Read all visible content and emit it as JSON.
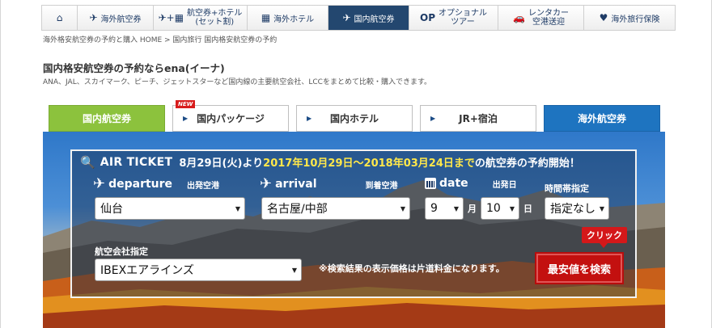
{
  "nav": {
    "items": [
      {
        "label": "",
        "icon": "home-icon",
        "glyph": "⌂"
      },
      {
        "label": "海外航空券",
        "icon": "plane-icon",
        "glyph": "✈"
      },
      {
        "label": "航空券+ホテル",
        "sub": "(セット割)",
        "icon": "plane-hotel-icon",
        "glyph": "✈+▦"
      },
      {
        "label": "海外ホテル",
        "icon": "hotel-icon",
        "glyph": "▦"
      },
      {
        "label": "国内航空券",
        "icon": "domestic-plane-icon",
        "glyph": "✈",
        "active": true
      },
      {
        "label": "オプショナル",
        "sub": "ツアー",
        "icon": "op-icon",
        "glyph": "OP"
      },
      {
        "label": "レンタカー",
        "sub": "空港送迎",
        "icon": "car-icon",
        "glyph": "🚗"
      },
      {
        "label": "海外旅行保険",
        "icon": "heart-icon",
        "glyph": "♥"
      }
    ]
  },
  "breadcrumb": "海外格安航空券の予約と購入 HOME > 国内旅行 国内格安航空券の予約",
  "headline": "国内格安航空券の予約ならena(イーナ)",
  "subline": "ANA、JAL、スカイマーク、ピーチ、ジェットスターなど国内線の主要航空会社、LCCをまとめて比較・購入できます。",
  "tabs": {
    "domestic_flight": "国内航空券",
    "package": "国内パッケージ",
    "new_badge": "NEW",
    "hotel": "国内ホテル",
    "jr": "JR+宿泊",
    "overseas": "海外航空券"
  },
  "panel": {
    "air_ticket": "AIR TICKET",
    "title_pre": "8月29日(火)より",
    "title_highlight": "2017年10月29日〜2018年03月24日まで",
    "title_post": "の航空券の予約開始！",
    "departure_en": "departure",
    "departure_jp": "出発空港",
    "departure_value": "仙台",
    "arrival_en": "arrival",
    "arrival_jp": "到着空港",
    "arrival_value": "名古屋/中部",
    "date_en": "date",
    "date_jp": "出発日",
    "month_value": "9",
    "month_unit": "月",
    "day_value": "10",
    "day_unit": "日",
    "time_jp": "時間帯指定",
    "time_value": "指定なし",
    "airline_jp": "航空会社指定",
    "airline_value": "IBEXエアラインズ",
    "note": "※検索結果の表示価格は片道料金になります。",
    "search_button": "最安値を検索",
    "click_tag": "クリック"
  },
  "colors": {
    "nav_active": "#23476f",
    "tab_domestic": "#8cc23d",
    "tab_overseas": "#1e74c0",
    "highlight": "#ffe84a",
    "search_red": "#c3100f"
  }
}
